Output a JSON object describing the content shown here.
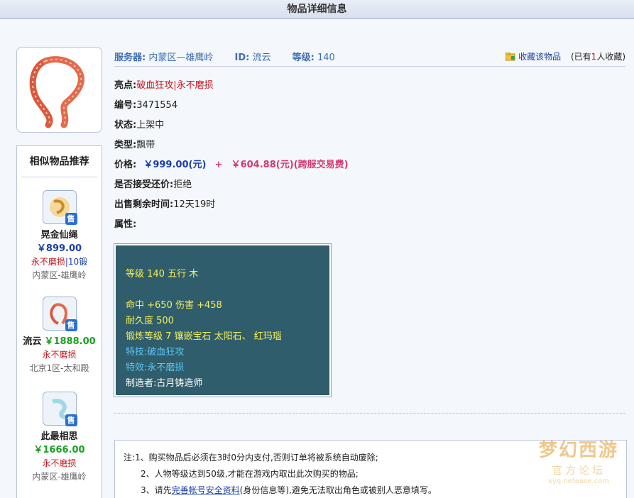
{
  "page": {
    "title": "物品详细信息"
  },
  "header": {
    "server_label": "服务器:",
    "server_value": "内蒙区—雄鹰岭",
    "id_label": "ID:",
    "id_value": "流云",
    "level_label": "等级:",
    "level_value": "140",
    "favorite_link": "收藏该物品",
    "favorite_prefix": "(已有",
    "favorite_count": "1",
    "favorite_suffix": "人收藏)"
  },
  "details": {
    "highlight_label": "亮点:",
    "highlight_value": "破血狂攻|永不磨损",
    "serial_label": "编号:",
    "serial_value": "3471554",
    "status_label": "状态:",
    "status_value": "上架中",
    "type_label": "类型:",
    "type_value": "飘带",
    "price_label": "价格:",
    "price_value": "￥999.00(元)",
    "price_plus": "+",
    "price_fee": "￥604.88(元)(跨服交易费)",
    "counter_label": "是否接受还价:",
    "counter_value": "拒绝",
    "time_label": "出售剩余时间:",
    "time_value": "12天19时",
    "attr_label": "属性:"
  },
  "attributes": {
    "line1": "等级 140 五行 木",
    "line2": "命中 +650 伤害 +458",
    "line3": "耐久度 500",
    "line4": "锻炼等级 7 镶嵌宝石 太阳石、 红玛瑙",
    "line5": "特技:破血狂攻",
    "line6": "特效:永不磨损",
    "line7": "制造者:古月铸造师"
  },
  "similar": {
    "title": "相似物品推荐",
    "badge": "售",
    "items": [
      {
        "name": "晃金仙绳",
        "price": "￥899.00",
        "tag": "永不磨损",
        "tag_extra": "|10锻",
        "server": "内蒙区-雄鹰岭"
      },
      {
        "name": "流云",
        "price": "￥1888.00",
        "tag": "永不磨损",
        "server": "北京1区-太和殿"
      },
      {
        "name": "此最相思",
        "price": "￥1666.00",
        "tag": "永不磨损",
        "server": "内蒙区-雄鹰岭"
      }
    ]
  },
  "notes": {
    "line1": "注:1、购买物品后必须在3时0分内支付,否则订单将被系统自动废除;",
    "line2": "2、人物等级达到50级,才能在游戏内取出此次购买的物品;",
    "line3_pre": "3、请先",
    "line3_link": "完善帐号安全资料",
    "line3_post": "(身份信息等),避免无法取出角色或被别人恶意填写。"
  },
  "watermark": {
    "logo": "梦幻西游",
    "sub": "官方论坛",
    "url": "xyq.netease.com"
  },
  "colors": {
    "price_blue": "#1a3ea8",
    "price_green": "#19a11c",
    "accent_red": "#c0141b",
    "attr_bg": "#2f5d6b",
    "attr_yellow": "#f5ef5a",
    "attr_cyan": "#5fc6f5"
  }
}
